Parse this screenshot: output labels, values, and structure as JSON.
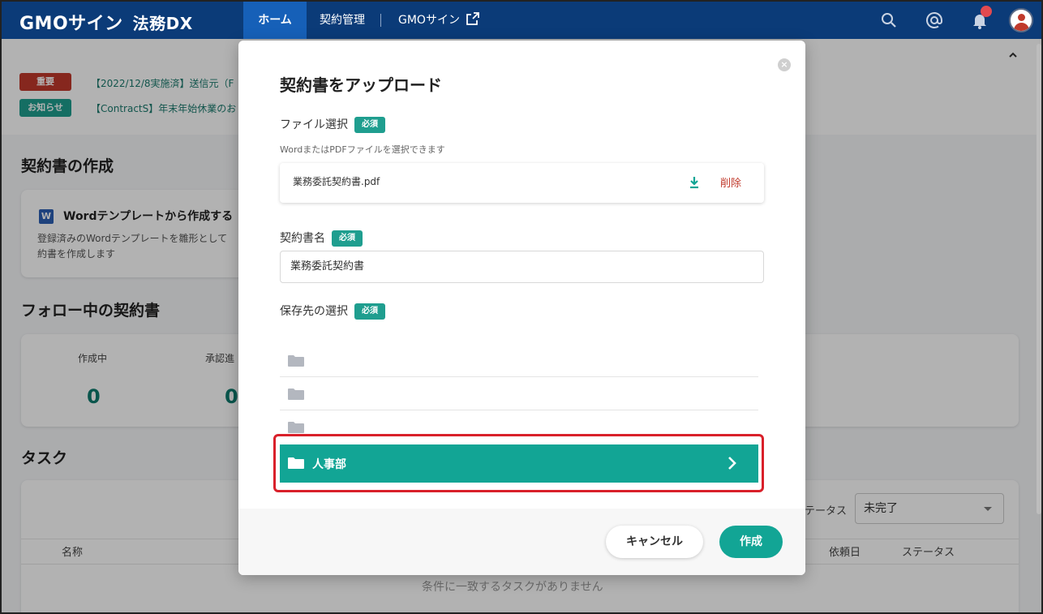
{
  "header": {
    "brand": "GMOサイン",
    "brand_sub": "法務DX",
    "nav": {
      "home": "ホーム",
      "contracts": "契約管理",
      "gmo_sign": "GMOサイン"
    }
  },
  "notices": [
    {
      "badge": "重要",
      "badge_color": "#c0392b",
      "text": "【2022/12/8実施済】送信元（F"
    },
    {
      "badge": "お知らせ",
      "badge_color": "#1f9e8f",
      "text": "【ContractS】年末年始休業のお"
    }
  ],
  "create_section": {
    "title": "契約書の作成",
    "word_card": {
      "icon": "W",
      "title": "Wordテンプレートから作成する",
      "desc_line1": "登録済みのWordテンプレートを雛形として",
      "desc_line2": "約書を作成します"
    }
  },
  "follow_section": {
    "title": "フォロー中の契約書",
    "stats": [
      {
        "label": "作成中",
        "value": "0"
      },
      {
        "label": "承認進",
        "value": "0"
      }
    ]
  },
  "task_section": {
    "title": "タスク",
    "filter_label": "テータス",
    "filter_value": "未完了",
    "columns": {
      "name": "名称",
      "request_date": "依頼日",
      "status": "ステータス"
    },
    "empty_message": "条件に一致するタスクがありません"
  },
  "modal": {
    "title": "契約書をアップロード",
    "file_label": "ファイル選択",
    "required": "必須",
    "file_hint": "WordまたはPDFファイルを選択できます",
    "file_name": "業務委託契約書.pdf",
    "delete_label": "削除",
    "name_label": "契約書名",
    "name_value": "業務委託契約書",
    "dest_label": "保存先の選択",
    "folders": [
      "",
      "",
      ""
    ],
    "selected_folder": "人事部",
    "cancel_label": "キャンセル",
    "create_label": "作成"
  },
  "colors": {
    "header_bg": "#0b3b78",
    "accent_teal": "#12a595",
    "highlight_red": "#d9202a"
  }
}
